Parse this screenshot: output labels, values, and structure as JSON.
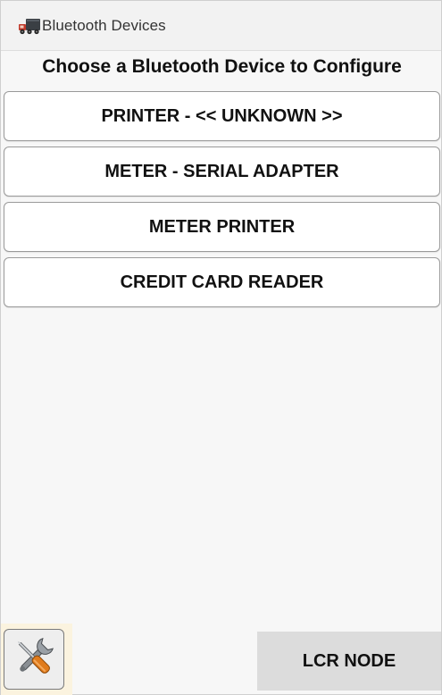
{
  "window": {
    "title": "Bluetooth Devices",
    "app_icon": "truck-icon"
  },
  "main": {
    "heading": "Choose a Bluetooth Device to Configure",
    "devices": [
      {
        "label": "PRINTER - << UNKNOWN >>"
      },
      {
        "label": "METER - SERIAL ADAPTER"
      },
      {
        "label": "METER PRINTER"
      },
      {
        "label": "CREDIT CARD READER"
      }
    ]
  },
  "footer": {
    "tools_icon": "wrench-screwdriver-icon",
    "lcr_node_label": "LCR NODE"
  },
  "colors": {
    "background": "#f7f7f7",
    "button_background": "#ffffff",
    "button_border": "#9a9a9a",
    "lcr_button_background": "#dcdcdc",
    "tools_background": "#fbf3df",
    "truck_red": "#c0392b"
  }
}
